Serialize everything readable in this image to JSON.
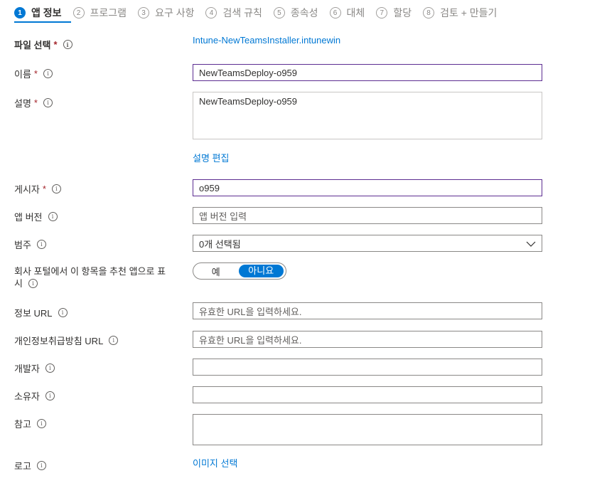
{
  "steps": [
    {
      "num": "1",
      "label": "앱 정보"
    },
    {
      "num": "2",
      "label": "프로그램"
    },
    {
      "num": "3",
      "label": "요구 사항"
    },
    {
      "num": "4",
      "label": "검색 규칙"
    },
    {
      "num": "5",
      "label": "종속성"
    },
    {
      "num": "6",
      "label": "대체"
    },
    {
      "num": "7",
      "label": "할당"
    },
    {
      "num": "8",
      "label": "검토 + 만들기"
    }
  ],
  "file": {
    "label": "파일 선택",
    "value": "Intune-NewTeamsInstaller.intunewin"
  },
  "name": {
    "label": "이름",
    "value": "NewTeamsDeploy-o959"
  },
  "description": {
    "label": "설명",
    "value": "NewTeamsDeploy-o959",
    "edit_link": "설명 편집"
  },
  "publisher": {
    "label": "게시자",
    "value": "o959"
  },
  "app_version": {
    "label": "앱 버전",
    "placeholder": "앱 버전 입력"
  },
  "category": {
    "label": "범주",
    "value": "0개 선택됨"
  },
  "featured": {
    "label_line1": "회사 포털에서 이 항목을 추천 앱으로 표",
    "label_line2": "시",
    "yes": "예",
    "no": "아니요"
  },
  "info_url": {
    "label": "정보 URL",
    "placeholder": "유효한 URL을 입력하세요."
  },
  "privacy_url": {
    "label": "개인정보취급방침 URL",
    "placeholder": "유효한 URL을 입력하세요."
  },
  "developer": {
    "label": "개발자",
    "value": ""
  },
  "owner": {
    "label": "소유자",
    "value": ""
  },
  "notes": {
    "label": "참고",
    "value": ""
  },
  "logo": {
    "label": "로고",
    "link": "이미지 선택"
  },
  "required_mark": "*",
  "info_glyph": "i",
  "chevron_glyph": "⌵",
  "colors": {
    "accent": "#0078d4",
    "focus_border": "#5c2d91",
    "required": "#a4262c"
  }
}
